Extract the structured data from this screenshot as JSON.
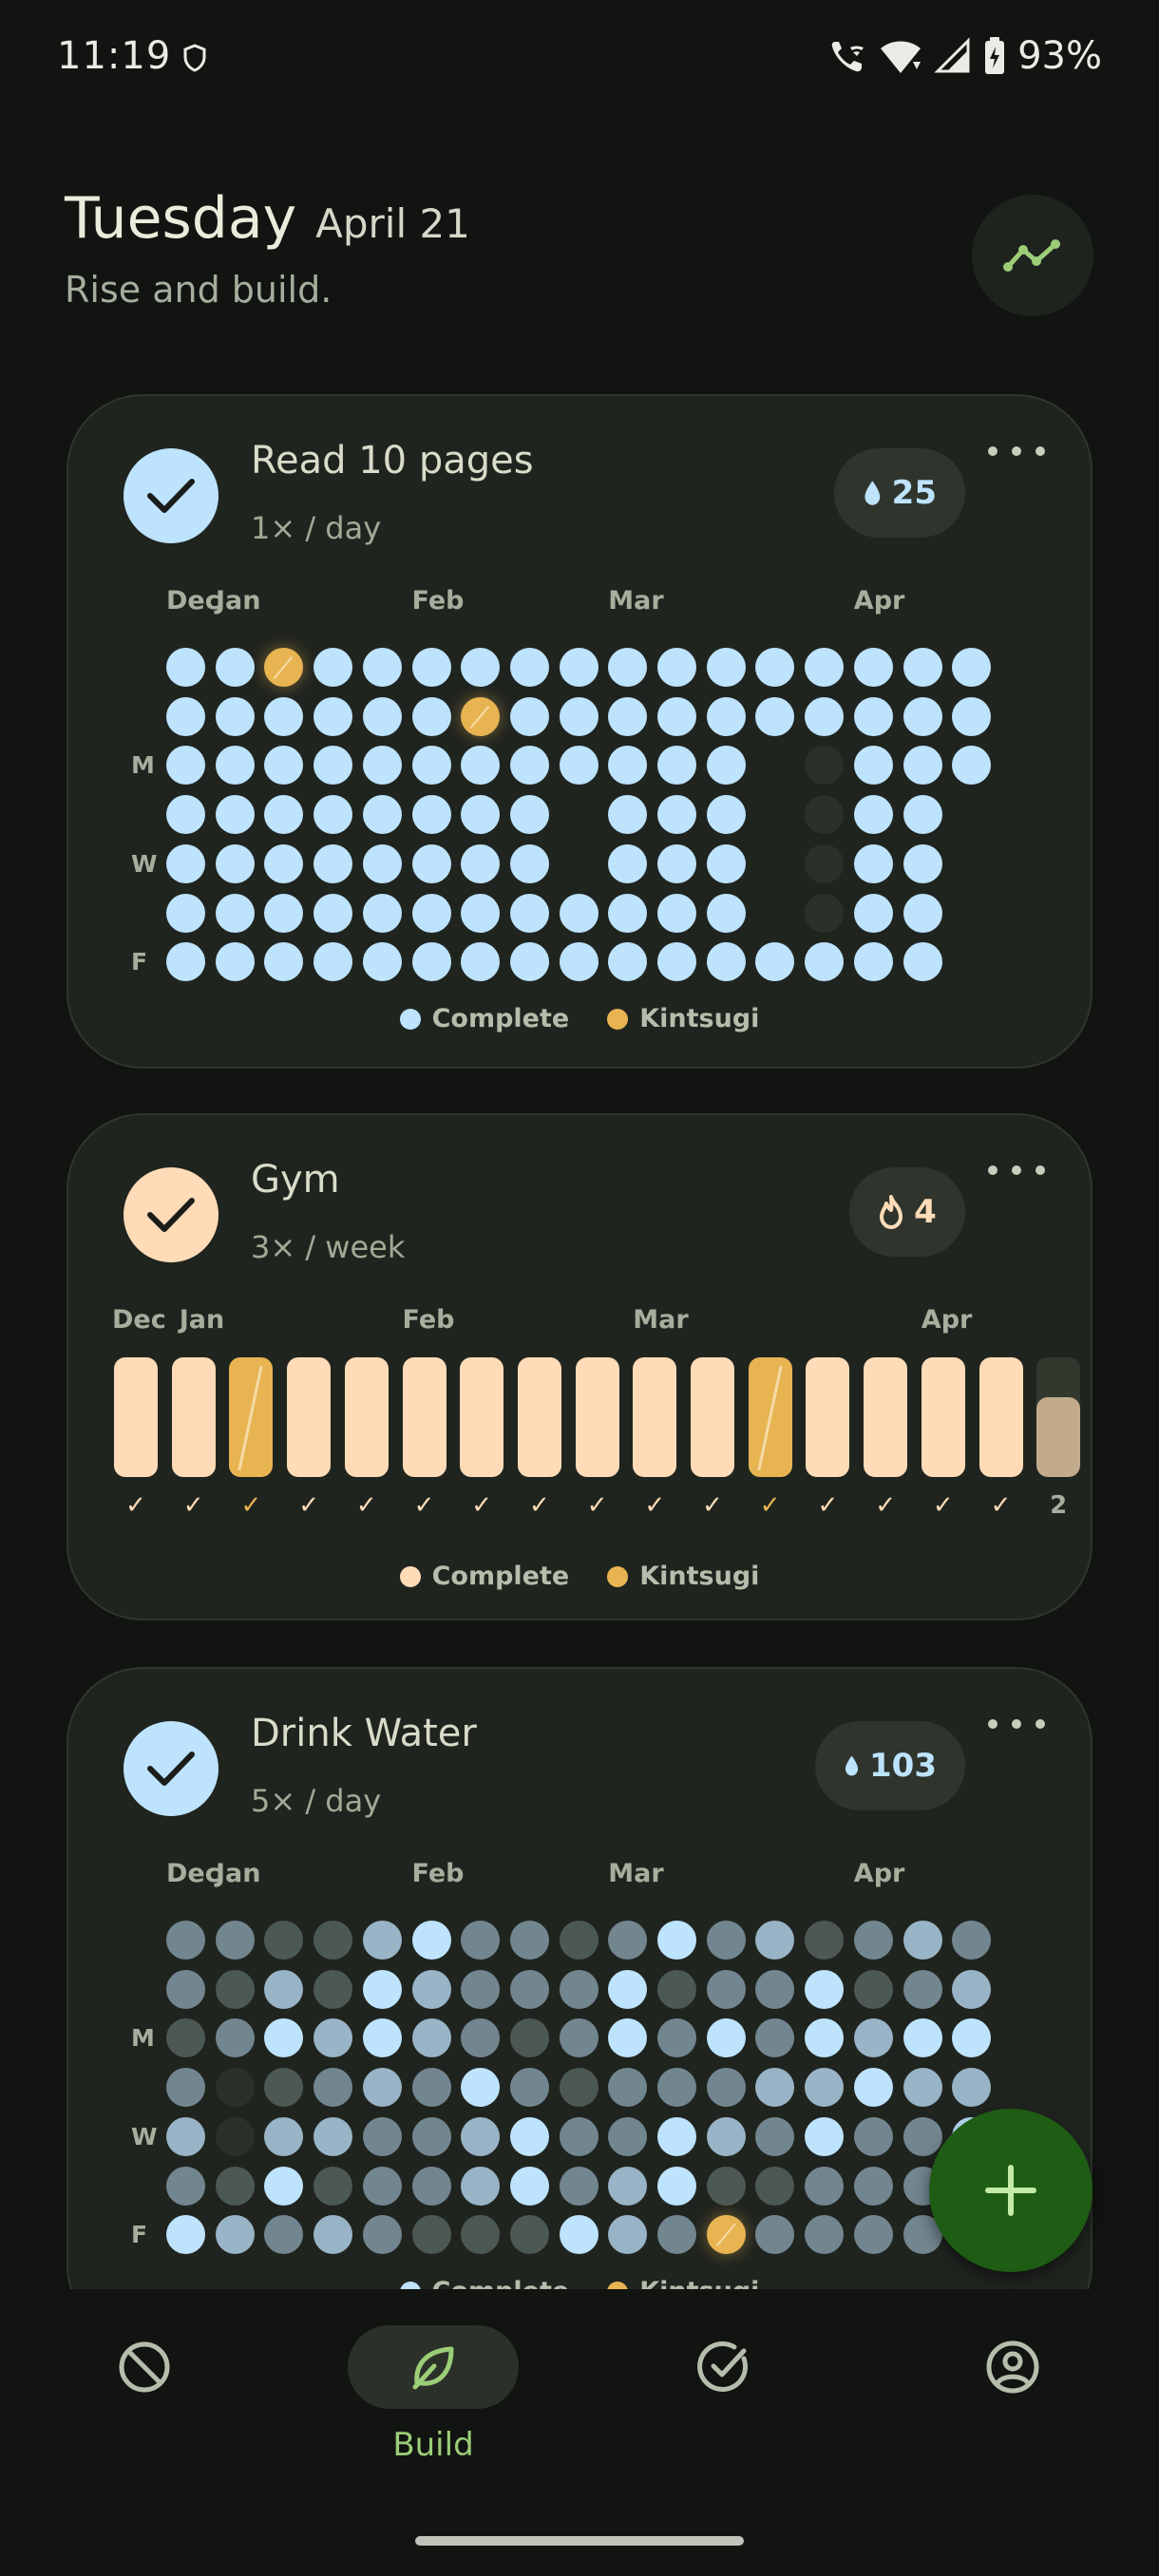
{
  "status": {
    "time": "11:19",
    "battery": "93%",
    "icons": [
      "shield-icon",
      "wifi-calling-icon",
      "wifi-icon",
      "signal-icon",
      "battery-charging-icon"
    ]
  },
  "header": {
    "day": "Tuesday",
    "date": "April 21",
    "tagline": "Rise and build.",
    "trend_icon": "trend-line-icon"
  },
  "colors": {
    "read_complete": "#bde3fd",
    "gym_complete": "#ffdcb7",
    "kintsugi": "#e8b452",
    "water_levels": [
      "#2b302b",
      "#4c5854",
      "#728690",
      "#98b4c6",
      "#bde3fd"
    ],
    "accent_green": "#9ccd77",
    "fab_bg": "#1f5c14"
  },
  "habits": [
    {
      "name": "Read 10 pages",
      "frequency": "1× / day",
      "streak": "25",
      "streak_icon": "water-drop-icon",
      "months": [
        {
          "label": "Dec",
          "col": 0
        },
        {
          "label": "Jan",
          "col": 1
        },
        {
          "label": "Feb",
          "col": 5
        },
        {
          "label": "Mar",
          "col": 9
        },
        {
          "label": "Apr",
          "col": 14
        }
      ],
      "day_labels": [
        "M",
        "W",
        "F"
      ],
      "grid": [
        "22K22222222222222",
        "222222K2222222222",
        "22222222222201222",
        "22222222022201220",
        "22222222022201220",
        "22222222222201220",
        "22222222222222220"
      ],
      "legend": {
        "complete": "Complete",
        "kintsugi": "Kintsugi"
      }
    },
    {
      "name": "Gym",
      "frequency": "3× / week",
      "streak": "4",
      "streak_icon": "flame-icon",
      "months": [
        {
          "label": "Dec",
          "col": 0
        },
        {
          "label": "Jan",
          "col": 1
        },
        {
          "label": "Feb",
          "col": 5
        },
        {
          "label": "Mar",
          "col": 9
        },
        {
          "label": "Apr",
          "col": 14
        }
      ],
      "weeks": [
        {
          "status": "complete",
          "mark": "✓"
        },
        {
          "status": "complete",
          "mark": "✓"
        },
        {
          "status": "kintsugi",
          "mark": "✓"
        },
        {
          "status": "complete",
          "mark": "✓"
        },
        {
          "status": "complete",
          "mark": "✓"
        },
        {
          "status": "complete",
          "mark": "✓"
        },
        {
          "status": "complete",
          "mark": "✓"
        },
        {
          "status": "complete",
          "mark": "✓"
        },
        {
          "status": "complete",
          "mark": "✓"
        },
        {
          "status": "complete",
          "mark": "✓"
        },
        {
          "status": "complete",
          "mark": "✓"
        },
        {
          "status": "kintsugi",
          "mark": "✓"
        },
        {
          "status": "complete",
          "mark": "✓"
        },
        {
          "status": "complete",
          "mark": "✓"
        },
        {
          "status": "complete",
          "mark": "✓"
        },
        {
          "status": "complete",
          "mark": "✓"
        },
        {
          "status": "partial",
          "mark": "2",
          "fill": 0.67
        }
      ],
      "legend": {
        "complete": "Complete",
        "kintsugi": "Kintsugi"
      }
    },
    {
      "name": "Drink Water",
      "frequency": "5× / day",
      "streak": "103",
      "streak_icon": "water-drop-icon",
      "months": [
        {
          "label": "Dec",
          "col": 0
        },
        {
          "label": "Jan",
          "col": 1
        },
        {
          "label": "Feb",
          "col": 5
        },
        {
          "label": "Mar",
          "col": 9
        },
        {
          "label": "Apr",
          "col": 14
        }
      ],
      "day_labels": [
        "M",
        "W",
        "F"
      ],
      "grid": [
        "22113422124231232",
        "21314322241224123",
        "12434321242424344",
        "20123242122233433",
        "30332234224324224",
        "21412234234112224",
        "43232111432K22222"
      ],
      "legend": {
        "complete": "Complete",
        "kintsugi": "Kintsugi"
      }
    }
  ],
  "fab": {
    "icon": "plus-icon"
  },
  "nav": {
    "items": [
      {
        "icon": "block-icon",
        "label": ""
      },
      {
        "icon": "leaf-icon",
        "label": "Build"
      },
      {
        "icon": "check-circle-icon",
        "label": ""
      },
      {
        "icon": "profile-icon",
        "label": ""
      }
    ]
  }
}
